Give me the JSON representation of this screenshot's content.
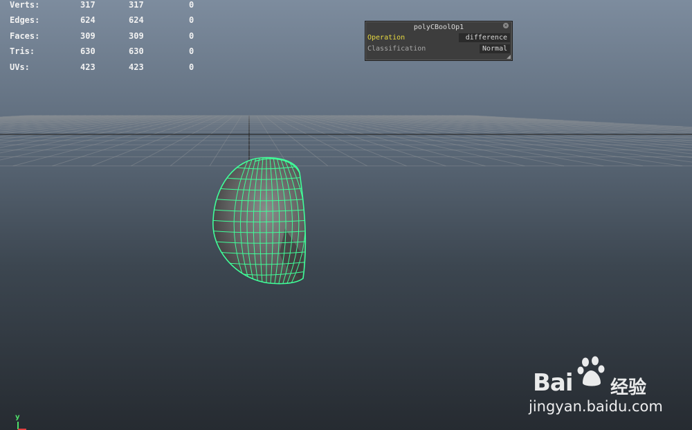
{
  "poly_count": {
    "rows": [
      {
        "label": "Verts:",
        "v1": "317",
        "v2": "317",
        "v3": "0"
      },
      {
        "label": "Edges:",
        "v1": "624",
        "v2": "624",
        "v3": "0"
      },
      {
        "label": "Faces:",
        "v1": "309",
        "v2": "309",
        "v3": "0"
      },
      {
        "label": "Tris:",
        "v1": "630",
        "v2": "630",
        "v3": "0"
      },
      {
        "label": "UVs:",
        "v1": "423",
        "v2": "423",
        "v3": "0"
      }
    ]
  },
  "attribute_panel": {
    "title": "polyCBoolOp1",
    "rows": [
      {
        "name": "Operation",
        "value": "difference"
      },
      {
        "name": "Classification",
        "value": "Normal"
      }
    ]
  },
  "axis_indicator": {
    "label": "y"
  },
  "watermark": {
    "brand_latin": "Bai",
    "brand_cjk": "经验",
    "url": "jingyan.baidu.com"
  },
  "colors": {
    "wireframe": "#3fff9a",
    "grid": "#8a8f94",
    "panel_label_active": "#e6d840"
  }
}
